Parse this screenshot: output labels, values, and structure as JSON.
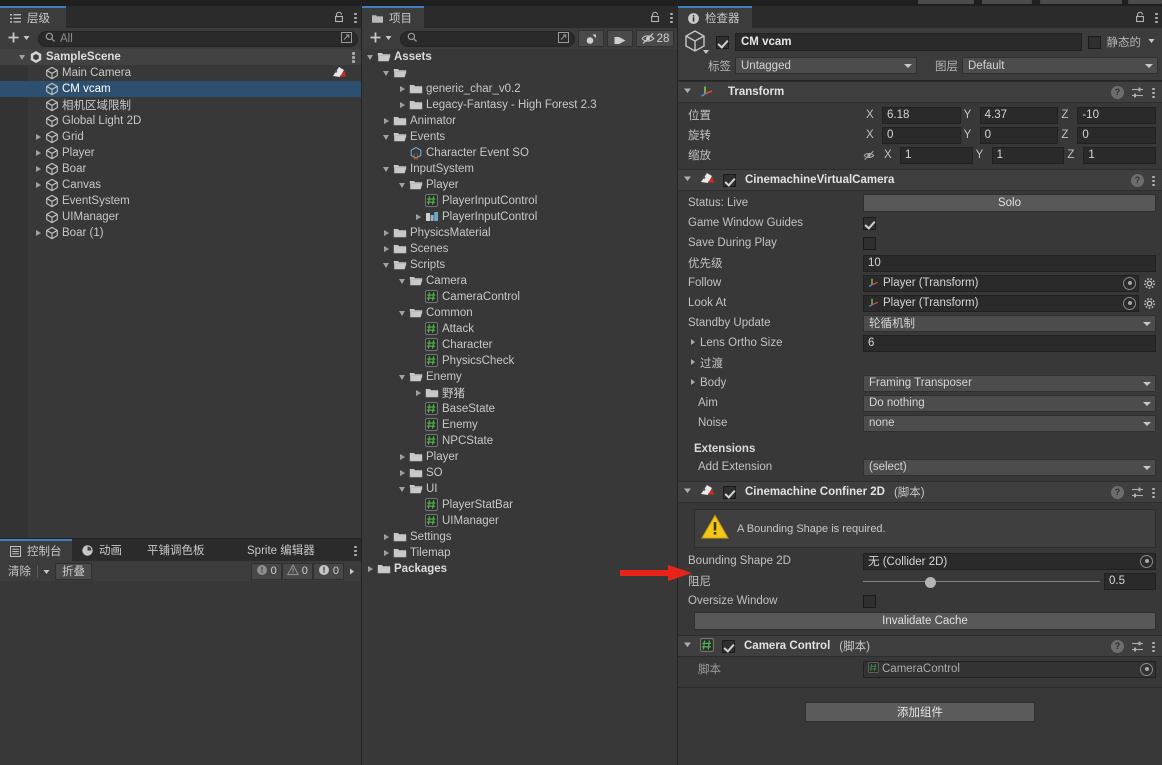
{
  "app": {
    "theme_bg": "#383838",
    "accent_blue": "#2d5070",
    "tab_accent": "#3f7fbf"
  },
  "hierarchy": {
    "tab_label": "层级",
    "tab_icon": "hierarchy-icon",
    "toolbar": {
      "add_label": "+",
      "search_placeholder": "All",
      "search_value": ""
    },
    "scene_name": "SampleScene",
    "items": [
      {
        "label": "Main Camera",
        "indent": 1,
        "expandable": false,
        "selected": false,
        "badge": "camera-preview-icon"
      },
      {
        "label": "CM vcam",
        "indent": 1,
        "expandable": false,
        "selected": true
      },
      {
        "label": "相机区域限制",
        "indent": 1,
        "expandable": false,
        "selected": false
      },
      {
        "label": "Global Light 2D",
        "indent": 1,
        "expandable": false,
        "selected": false
      },
      {
        "label": "Grid",
        "indent": 1,
        "expandable": true,
        "selected": false
      },
      {
        "label": "Player",
        "indent": 1,
        "expandable": true,
        "selected": false
      },
      {
        "label": "Boar",
        "indent": 1,
        "expandable": true,
        "selected": false
      },
      {
        "label": "Canvas",
        "indent": 1,
        "expandable": true,
        "selected": false
      },
      {
        "label": "EventSystem",
        "indent": 1,
        "expandable": false,
        "selected": false
      },
      {
        "label": "UIManager",
        "indent": 1,
        "expandable": false,
        "selected": false
      },
      {
        "label": "Boar (1)",
        "indent": 1,
        "expandable": true,
        "selected": false
      }
    ]
  },
  "project": {
    "tab_label": "项目",
    "toolbar": {
      "add_label": "+",
      "search_placeholder": "",
      "hidden_count": "28"
    },
    "items": [
      {
        "label": "Assets",
        "indent": 0,
        "arrow": "open",
        "icon": "folder-open-icon",
        "bold": true
      },
      {
        "label": "",
        "indent": 1,
        "arrow": "open",
        "icon": "folder-open-icon"
      },
      {
        "label": "generic_char_v0.2",
        "indent": 2,
        "arrow": "closed",
        "icon": "folder-icon"
      },
      {
        "label": "Legacy-Fantasy - High Forest 2.3",
        "indent": 2,
        "arrow": "closed",
        "icon": "folder-icon"
      },
      {
        "label": "Animator",
        "indent": 1,
        "arrow": "closed",
        "icon": "folder-icon"
      },
      {
        "label": "Events",
        "indent": 1,
        "arrow": "open",
        "icon": "folder-open-icon"
      },
      {
        "label": "Character Event SO",
        "indent": 2,
        "arrow": "none",
        "icon": "scriptable-object-icon"
      },
      {
        "label": "InputSystem",
        "indent": 1,
        "arrow": "open",
        "icon": "folder-open-icon"
      },
      {
        "label": "Player",
        "indent": 2,
        "arrow": "open",
        "icon": "folder-open-icon"
      },
      {
        "label": "PlayerInputControl",
        "indent": 3,
        "arrow": "none",
        "icon": "cs-script-icon"
      },
      {
        "label": "PlayerInputControl",
        "indent": 3,
        "arrow": "closed",
        "icon": "input-actions-icon"
      },
      {
        "label": "PhysicsMaterial",
        "indent": 1,
        "arrow": "closed",
        "icon": "folder-icon"
      },
      {
        "label": "Scenes",
        "indent": 1,
        "arrow": "closed",
        "icon": "folder-icon"
      },
      {
        "label": "Scripts",
        "indent": 1,
        "arrow": "open",
        "icon": "folder-open-icon"
      },
      {
        "label": "Camera",
        "indent": 2,
        "arrow": "open",
        "icon": "folder-open-icon"
      },
      {
        "label": "CameraControl",
        "indent": 3,
        "arrow": "none",
        "icon": "cs-script-icon"
      },
      {
        "label": "Common",
        "indent": 2,
        "arrow": "open",
        "icon": "folder-open-icon"
      },
      {
        "label": "Attack",
        "indent": 3,
        "arrow": "none",
        "icon": "cs-script-icon"
      },
      {
        "label": "Character",
        "indent": 3,
        "arrow": "none",
        "icon": "cs-script-icon"
      },
      {
        "label": "PhysicsCheck",
        "indent": 3,
        "arrow": "none",
        "icon": "cs-script-icon"
      },
      {
        "label": "Enemy",
        "indent": 2,
        "arrow": "open",
        "icon": "folder-open-icon"
      },
      {
        "label": "野猪",
        "indent": 3,
        "arrow": "closed",
        "icon": "folder-icon"
      },
      {
        "label": "BaseState",
        "indent": 3,
        "arrow": "none",
        "icon": "cs-script-icon"
      },
      {
        "label": "Enemy",
        "indent": 3,
        "arrow": "none",
        "icon": "cs-script-icon"
      },
      {
        "label": "NPCState",
        "indent": 3,
        "arrow": "none",
        "icon": "cs-script-icon"
      },
      {
        "label": "Player",
        "indent": 2,
        "arrow": "closed",
        "icon": "folder-icon"
      },
      {
        "label": "SO",
        "indent": 2,
        "arrow": "closed",
        "icon": "folder-icon"
      },
      {
        "label": "UI",
        "indent": 2,
        "arrow": "open",
        "icon": "folder-open-icon"
      },
      {
        "label": "PlayerStatBar",
        "indent": 3,
        "arrow": "none",
        "icon": "cs-script-icon"
      },
      {
        "label": "UIManager",
        "indent": 3,
        "arrow": "none",
        "icon": "cs-script-icon"
      },
      {
        "label": "Settings",
        "indent": 1,
        "arrow": "closed",
        "icon": "folder-icon"
      },
      {
        "label": "Tilemap",
        "indent": 1,
        "arrow": "closed",
        "icon": "folder-icon"
      },
      {
        "label": "Packages",
        "indent": 0,
        "arrow": "closed",
        "icon": "folder-icon",
        "bold": true
      }
    ]
  },
  "console": {
    "tabs": [
      {
        "label": "控制台",
        "icon": "console-icon",
        "active": true
      },
      {
        "label": "动画",
        "icon": "animation-icon",
        "active": false
      },
      {
        "label": "平铺调色板",
        "icon": "",
        "active": false
      },
      {
        "label": "Sprite 编辑器",
        "icon": "",
        "active": false
      }
    ],
    "clear_label": "清除",
    "collapse_label": "折叠",
    "counts": {
      "log": "0",
      "warning": "0",
      "error": "0"
    }
  },
  "inspector": {
    "tab_label": "检查器",
    "object": {
      "name": "CM vcam",
      "enabled": true,
      "static_label": "静态的",
      "static_checked": false,
      "tag_label": "标签",
      "tag_value": "Untagged",
      "layer_label": "图层",
      "layer_value": "Default"
    },
    "transform": {
      "title": "Transform",
      "rows": [
        {
          "label": "位置",
          "x": "6.18",
          "y": "4.37",
          "z": "-10"
        },
        {
          "label": "旋转",
          "x": "0",
          "y": "0",
          "z": "0"
        },
        {
          "label": "缩放",
          "x": "1",
          "y": "1",
          "z": "1"
        }
      ],
      "axis_labels": [
        "X",
        "Y",
        "Z"
      ],
      "scale_lock_icon": "link-off-icon"
    },
    "vcam": {
      "title": "CinemachineVirtualCamera",
      "enabled": true,
      "status_label": "Status: Live",
      "solo_label": "Solo",
      "game_window_guides_label": "Game Window Guides",
      "game_window_guides": true,
      "save_during_play_label": "Save During Play",
      "save_during_play": false,
      "priority_label": "优先级",
      "priority_value": "10",
      "follow_label": "Follow",
      "follow_value": "Player (Transform)",
      "lookat_label": "Look At",
      "lookat_value": "Player (Transform)",
      "standby_label": "Standby Update",
      "standby_value": "轮循机制",
      "lens_label": "Lens Ortho Size",
      "lens_value": "6",
      "transition_label": "过渡",
      "body_label": "Body",
      "body_value": "Framing Transposer",
      "aim_label": "Aim",
      "aim_value": "Do nothing",
      "noise_label": "Noise",
      "noise_value": "none",
      "extensions_label": "Extensions",
      "add_extension_label": "Add Extension",
      "add_extension_value": "(select)"
    },
    "confiner": {
      "title": "Cinemachine Confiner 2D",
      "subtitle": "(脚本)",
      "enabled": true,
      "warning": "A Bounding Shape is required.",
      "bounding_label": "Bounding Shape 2D",
      "bounding_value": "无 (Collider 2D)",
      "damping_label": "阻尼",
      "damping_value": "0.5",
      "oversize_label": "Oversize Window",
      "oversize_checked": false,
      "invalidate_label": "Invalidate Cache"
    },
    "camera_control": {
      "title": "Camera Control",
      "subtitle": "(脚本)",
      "enabled": true,
      "script_label": "脚本",
      "script_value": "CameraControl"
    },
    "add_component_label": "添加组件"
  },
  "annotation": {
    "arrow_color": "#e8231a",
    "arrow_name": "red-pointer-arrow"
  }
}
